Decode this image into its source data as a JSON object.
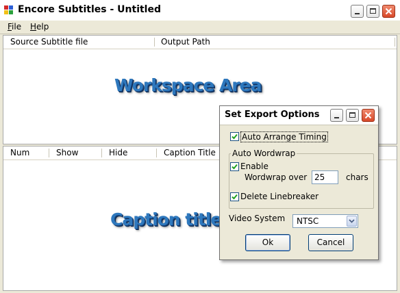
{
  "window": {
    "title": "Encore Subtitles - Untitled",
    "icon": "app-icon",
    "controls": [
      "minimize-icon",
      "maximize-icon",
      "close-icon"
    ]
  },
  "menu": {
    "items": [
      {
        "label": "File",
        "mnemonic": "F",
        "rest": "ile"
      },
      {
        "label": "Help",
        "mnemonic": "H",
        "rest": "elp"
      }
    ]
  },
  "workspace": {
    "columns": [
      "Source Subtitle file",
      "Output Path"
    ],
    "watermark": "Workspace Area"
  },
  "captions": {
    "columns": [
      "Num",
      "Show",
      "Hide",
      "Caption Title"
    ],
    "watermark": "Caption title"
  },
  "dialog": {
    "title": "Set Export Options",
    "auto_arrange": {
      "label": "Auto Arrange Timing",
      "checked": true
    },
    "wordwrap_group": {
      "legend": "Auto Wordwrap",
      "enable": {
        "label": "Enable",
        "checked": true
      },
      "wordwrap_over_label": "Wordwrap over",
      "wordwrap_value": "25",
      "chars_label": "chars",
      "delete_linebreaker": {
        "label": "Delete Linebreaker",
        "checked": true
      }
    },
    "video_system": {
      "label": "Video System",
      "selected": "NTSC"
    },
    "ok_label": "Ok",
    "cancel_label": "Cancel"
  },
  "colors": {
    "watermark_text": "#2e78bd",
    "close_button": "#d8492a",
    "checkmark": "#21a121",
    "window_bg": "#ece9d8"
  }
}
